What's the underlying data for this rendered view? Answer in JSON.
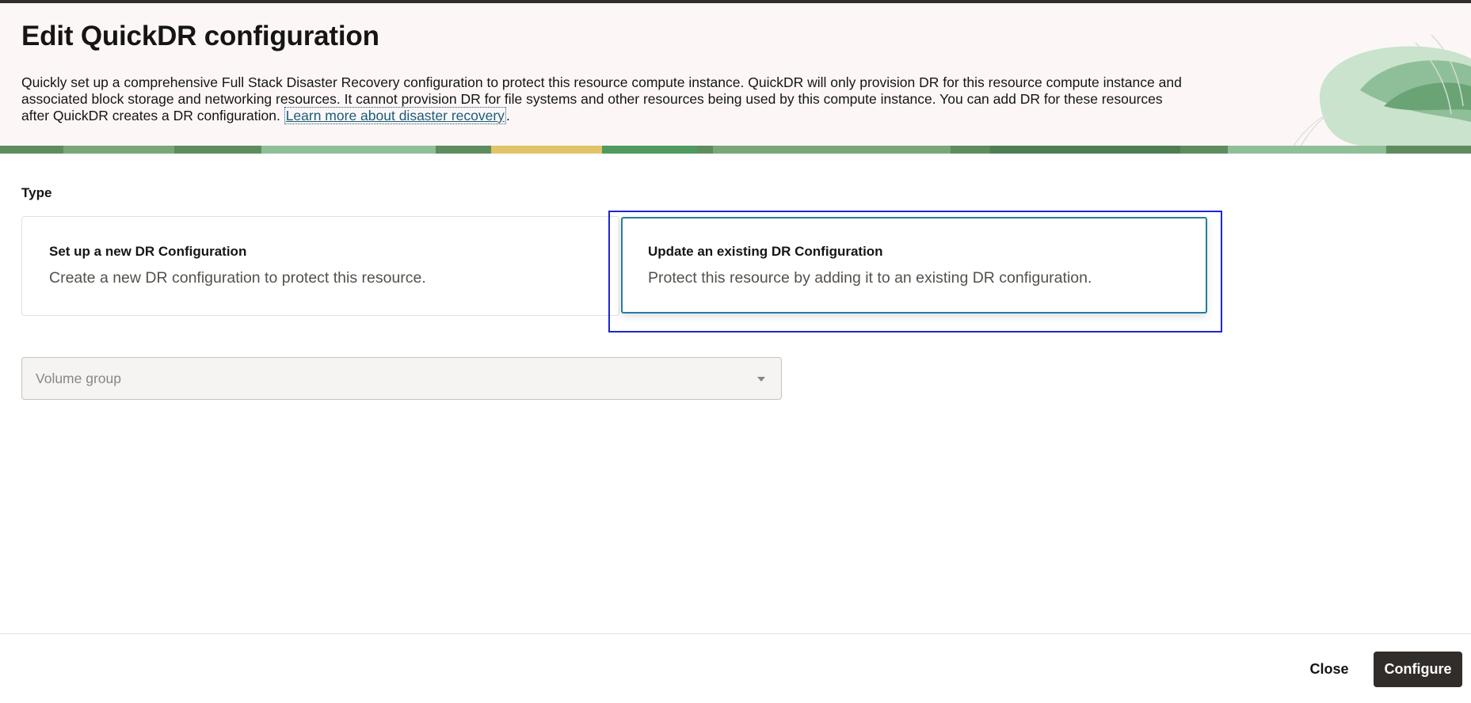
{
  "header": {
    "title": "Edit QuickDR configuration",
    "description": "Quickly set up a comprehensive Full Stack Disaster Recovery configuration to protect this resource compute instance. QuickDR will only provision DR for this resource compute instance and associated block storage and networking resources. It cannot provision DR for file systems and other resources being used by this compute instance. You can add DR for these resources after QuickDR creates a DR configuration.",
    "learn_more_link": "Learn more about disaster recovery",
    "learn_more_suffix": "."
  },
  "type_section": {
    "label": "Type",
    "options": [
      {
        "title": "Set up a new DR Configuration",
        "subtitle": "Create a new DR configuration to protect this resource.",
        "selected": false
      },
      {
        "title": "Update an existing DR Configuration",
        "subtitle": "Protect this resource by adding it to an existing DR configuration.",
        "selected": true
      }
    ]
  },
  "volume_group": {
    "placeholder": "Volume group",
    "disabled": true
  },
  "footer": {
    "close_label": "Close",
    "configure_label": "Configure"
  },
  "colors": {
    "header_bg": "#fcf7f6",
    "selected_card_border": "#227e9e",
    "focus_ring": "#1f25d6",
    "primary_button": "#312d2a",
    "link": "#1a5c7a"
  }
}
